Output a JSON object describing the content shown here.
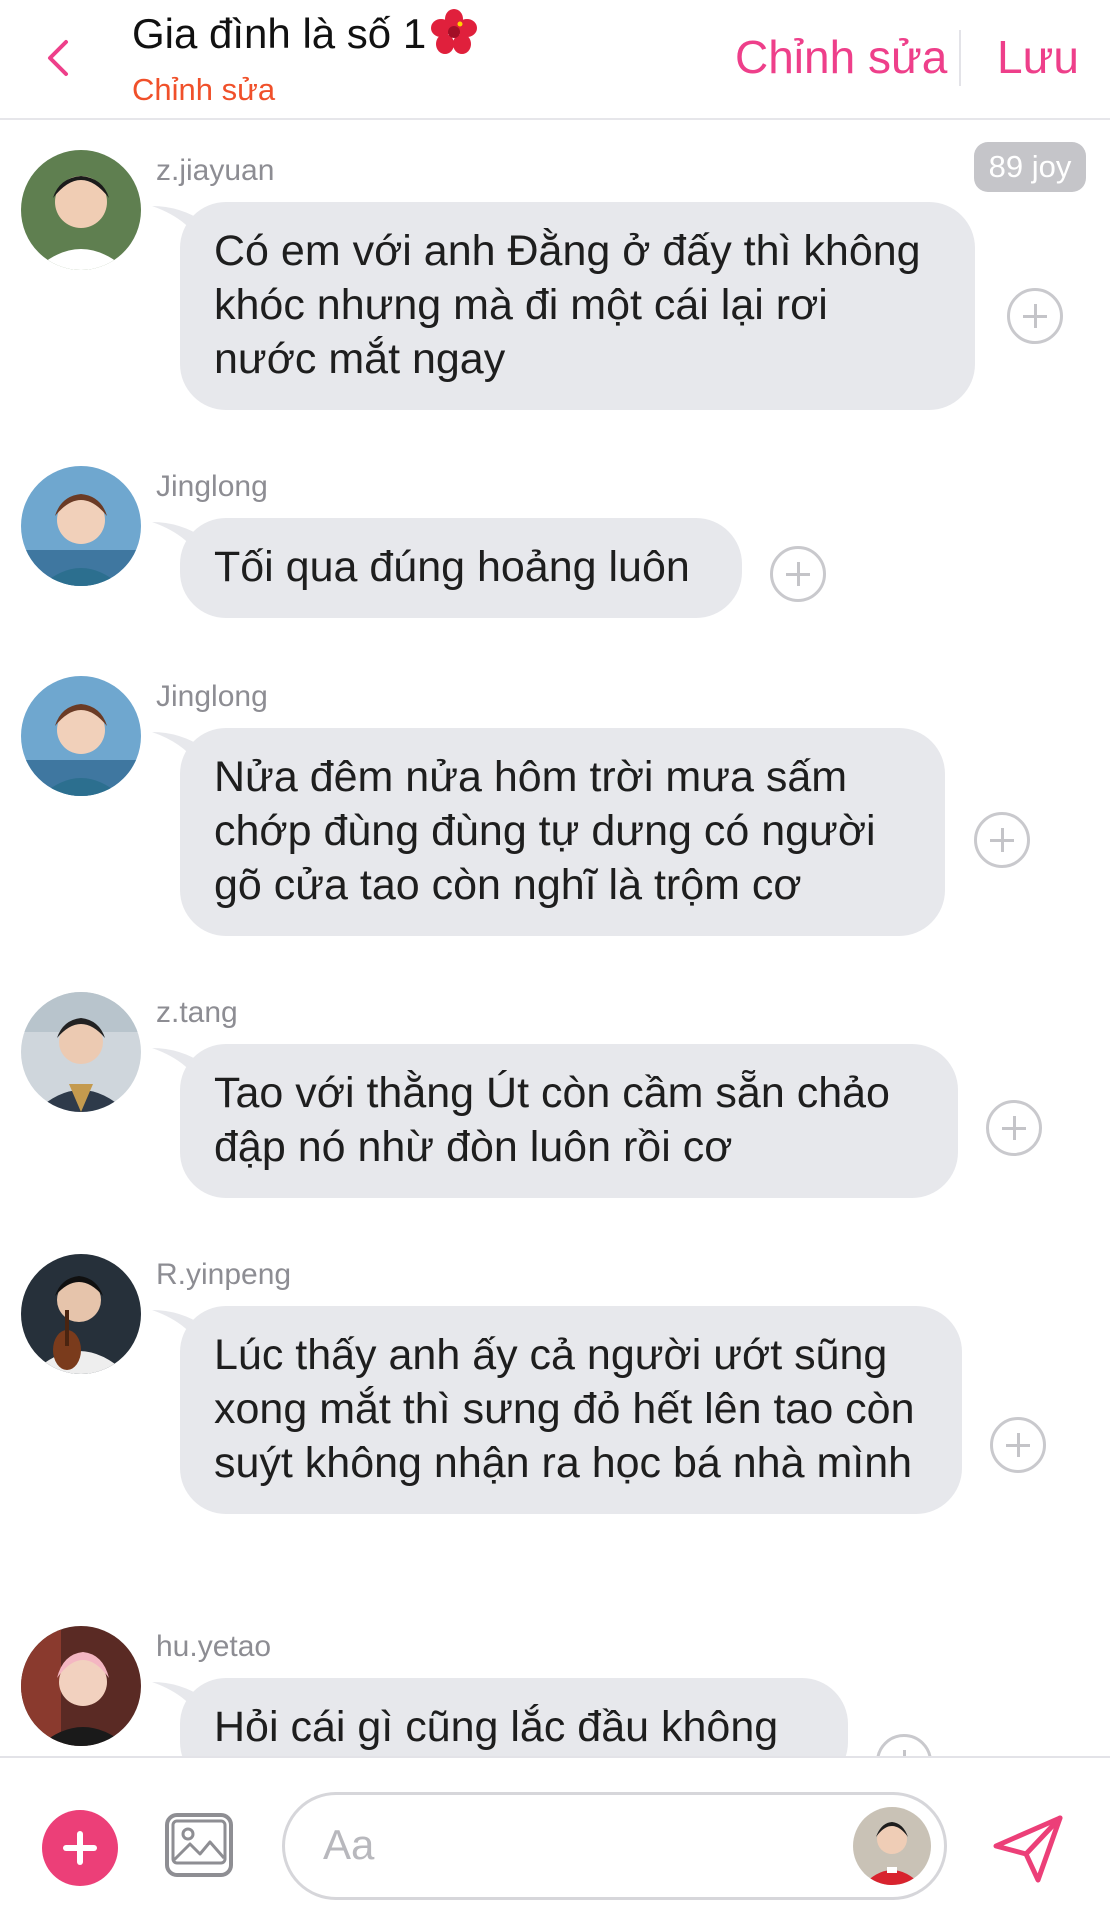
{
  "header": {
    "back_icon": "chevron-left-icon",
    "title": "Gia đình là số 1",
    "title_emoji": "hibiscus-flower-icon",
    "subtitle": "Chỉnh sửa",
    "edit_label": "Chỉnh sửa",
    "save_label": "Lưu",
    "accent_color": "#ee3f8a",
    "subtitle_color": "#f0502a"
  },
  "chat": {
    "joy_badge": "89 joy",
    "messages": [
      {
        "sender": "z.jiayuan",
        "text": "Có em với anh Đằng ở đấy thì không khóc nhưng mà đi một cái lại rơi nước mắt ngay"
      },
      {
        "sender": "Jinglong",
        "text": "Tối qua đúng hoảng luôn"
      },
      {
        "sender": "Jinglong",
        "text": "Nửa đêm nửa hôm trời mưa sấm chớp đùng đùng tự dưng có người gõ cửa tao còn nghĩ là trộm cơ"
      },
      {
        "sender": "z.tang",
        "text": "Tao với thằng Út còn cầm sẵn chảo đập nó nhừ đòn luôn rồi cơ"
      },
      {
        "sender": "R.yinpeng",
        "text": "Lúc thấy anh ấy cả người ướt sũng xong mắt thì sưng đỏ hết lên tao còn suýt không nhận ra học bá nhà mình"
      },
      {
        "sender": "hu.yetao",
        "text": "Hỏi cái gì cũng lắc đầu không"
      }
    ],
    "bubble_color": "#e7e8ec"
  },
  "composer": {
    "placeholder": "Aa",
    "add_icon": "plus-circle-icon",
    "image_icon": "image-icon",
    "send_icon": "send-icon",
    "plus_color": "#ec3f78"
  }
}
